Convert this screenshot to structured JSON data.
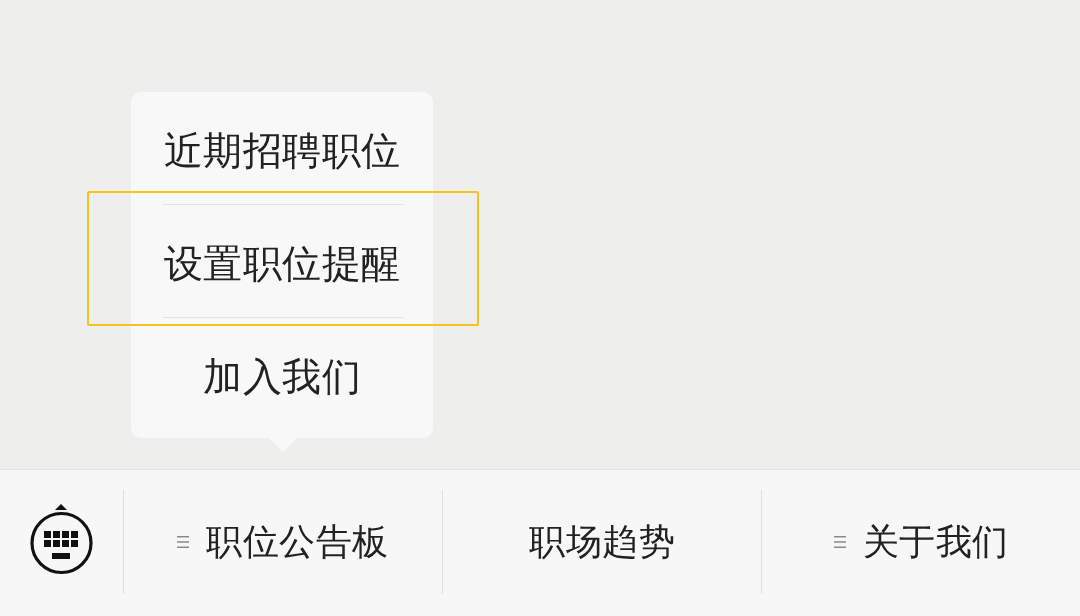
{
  "popup_menu": {
    "items": [
      {
        "label": "近期招聘职位",
        "highlighted": false
      },
      {
        "label": "设置职位提醒",
        "highlighted": true
      },
      {
        "label": "加入我们",
        "highlighted": false
      }
    ]
  },
  "bottom_bar": {
    "tabs": [
      {
        "label": "职位公告板",
        "has_submenu": true
      },
      {
        "label": "职场趋势",
        "has_submenu": false
      },
      {
        "label": "关于我们",
        "has_submenu": true
      }
    ]
  }
}
